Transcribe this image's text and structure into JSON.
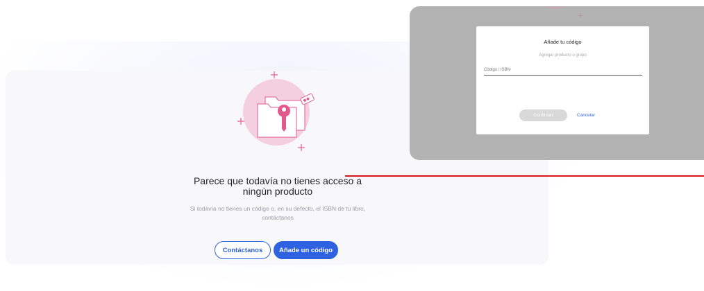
{
  "empty_state": {
    "title": "Parece que todavía no tienes acceso a ningún producto",
    "subtitle": "Si todavía no tienes un código o, en su defecto, el ISBN de tu libro, contáctanos",
    "contact_button": "Contáctanos",
    "add_code_button": "Añade un código",
    "illustration_icon": "folder-key-icon"
  },
  "modal": {
    "title": "Añade tu código",
    "subtitle": "Agregar producto o grupo",
    "field_label": "Código / ISBN",
    "field_value": "",
    "continue_button": "Continuar",
    "cancel_button": "Cancelar"
  },
  "colors": {
    "primary": "#2f62e0",
    "accent_pink": "#e05a8c",
    "annotation_red": "#d8151a",
    "overlay": "#b3b3b3"
  }
}
